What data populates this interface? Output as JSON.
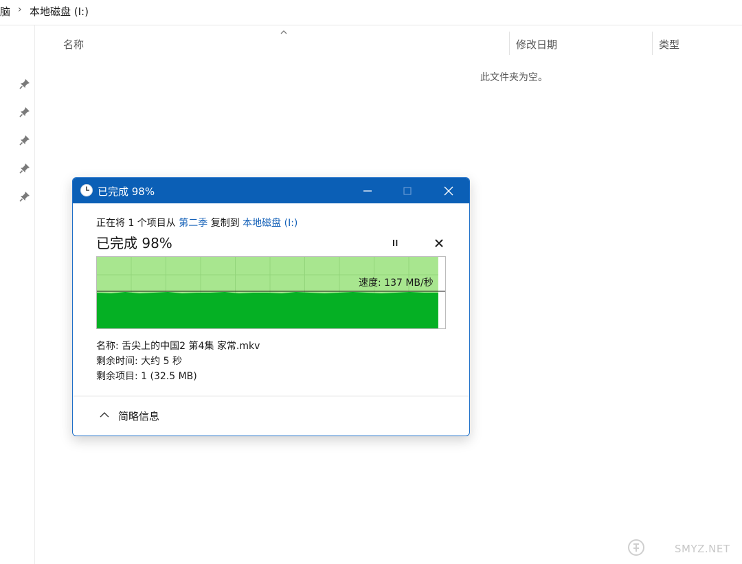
{
  "breadcrumb": {
    "items": [
      "脑",
      "本地磁盘 (I:)"
    ],
    "separator": "›"
  },
  "columns": {
    "name": "名称",
    "modified": "修改日期",
    "type": "类型"
  },
  "empty_message": "此文件夹为空。",
  "nav_pins": [
    "pin-icon",
    "pin-icon",
    "pin-icon",
    "pin-icon",
    "pin-icon"
  ],
  "dialog": {
    "title": "已完成 98%",
    "description": {
      "prefix": "正在将 1 个项目从 ",
      "source": "第二季",
      "middle": " 复制到 ",
      "destination": "本地磁盘 (I:)"
    },
    "status": "已完成 98%",
    "progress": 0.98,
    "speed": "速度: 137 MB/秒",
    "details": {
      "name": "名称: 舌尖上的中国2 第4集 家常.mkv",
      "time_remaining": "剩余时间: 大约 5 秒",
      "items_remaining": "剩余项目: 1 (32.5 MB)"
    },
    "less_details": "简略信息"
  },
  "watermark": "SMYZ.NET",
  "colors": {
    "titlebar": "#0b5fb6",
    "link": "#1461b8",
    "graph_fill": "#05b024",
    "graph_done": "#a8e68f"
  }
}
